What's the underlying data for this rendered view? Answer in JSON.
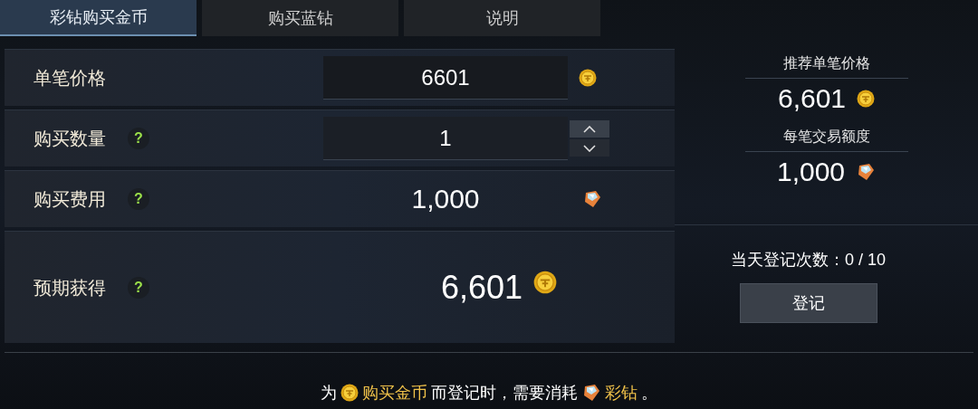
{
  "tabs": [
    {
      "label": "彩钻购买金币",
      "selected": true
    },
    {
      "label": "购买蓝钻",
      "selected": false
    },
    {
      "label": "说明",
      "selected": false
    }
  ],
  "rows": [
    {
      "kind": "field",
      "label": "单笔价格",
      "value": "6601",
      "unit": {
        "kind": "coin"
      }
    },
    {
      "kind": "stepper",
      "label": "购买数量",
      "help": "?",
      "value": "1"
    },
    {
      "kind": "value",
      "label": "购买费用",
      "help": "?",
      "value": "1,000",
      "unit": {
        "kind": "gem"
      }
    },
    {
      "kind": "big",
      "label": "预期获得",
      "help": "?",
      "value": "6,601",
      "unit": {
        "kind": "coin"
      }
    }
  ],
  "summary": [
    {
      "label": "推荐单笔价格",
      "value": "6,601",
      "unit": {
        "kind": "coin"
      }
    },
    {
      "label": "每笔交易额度",
      "value": "1,000",
      "unit": {
        "kind": "gem"
      }
    }
  ],
  "register": {
    "count_label": "当天登记次数：0 / 10",
    "button": "登记"
  },
  "note": [
    {
      "kind": "text",
      "text": "为"
    },
    {
      "kind": "coin"
    },
    {
      "kind": "highlight",
      "text": "购买金币"
    },
    {
      "kind": "text",
      "text": "而登记时，需要消耗"
    },
    {
      "kind": "gem"
    },
    {
      "kind": "highlight",
      "text": "彩钻"
    },
    {
      "kind": "text",
      "text": "。"
    }
  ]
}
